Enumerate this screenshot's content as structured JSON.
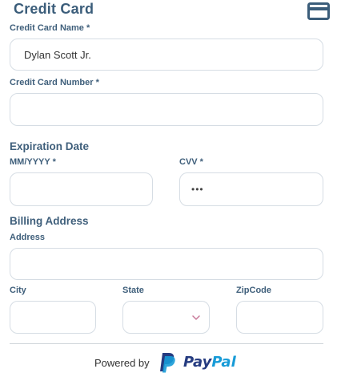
{
  "header": {
    "title": "Credit Card",
    "icon": "credit-card-icon"
  },
  "fields": {
    "card_name": {
      "label": "Credit Card Name *",
      "value": "Dylan Scott Jr."
    },
    "card_number": {
      "label": "Credit Card Number *",
      "value": ""
    },
    "expiration": {
      "label": "MM/YYYY *",
      "value": ""
    },
    "cvv": {
      "label": "CVV *",
      "value": "•••"
    },
    "address": {
      "label": "Address",
      "value": ""
    },
    "city": {
      "label": "City",
      "value": ""
    },
    "state": {
      "label": "State",
      "value": ""
    },
    "zip": {
      "label": "ZipCode",
      "value": ""
    }
  },
  "sections": {
    "expiration_title": "Expiration Date",
    "billing_title": "Billing Address"
  },
  "footer": {
    "powered_by": "Powered by",
    "paypal_pay": "Pay",
    "paypal_pal": "Pal"
  },
  "colors": {
    "accent": "#3b5d7a",
    "border": "#d6dde4",
    "paypal_dark": "#253b80",
    "paypal_light": "#179bd7",
    "chevron": "#c97a9a"
  }
}
